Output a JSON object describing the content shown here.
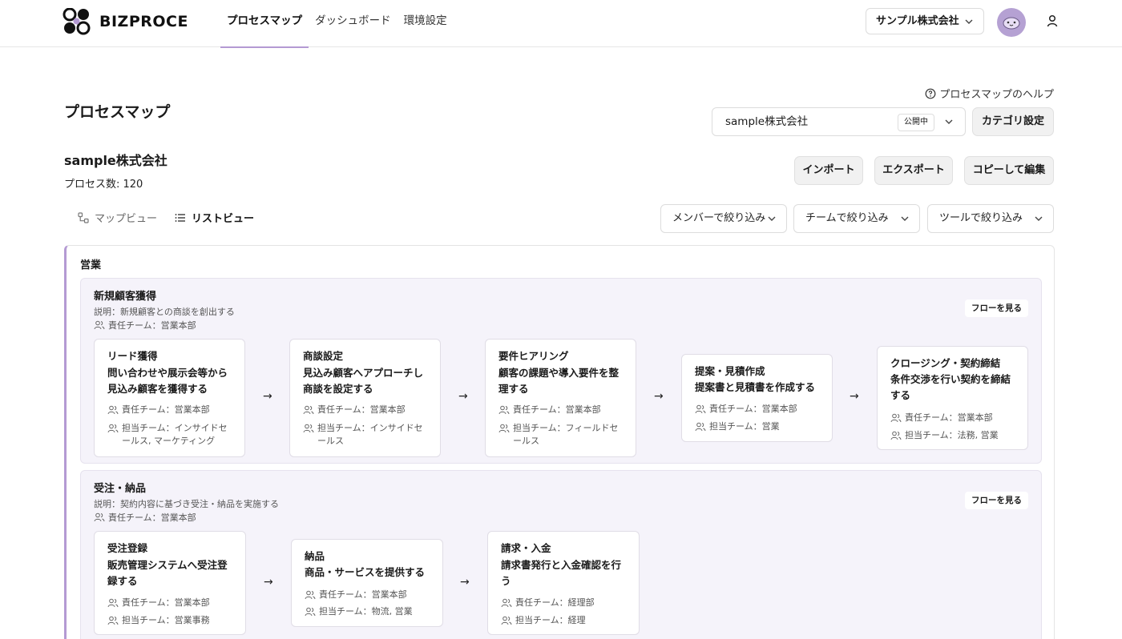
{
  "brand": {
    "name": "BIZPROCE"
  },
  "nav": {
    "items": [
      {
        "label": "プロセスマップ",
        "active": true
      },
      {
        "label": "ダッシュボード",
        "active": false
      },
      {
        "label": "環境設定",
        "active": false
      }
    ]
  },
  "header": {
    "org_select": "サンプル株式会社"
  },
  "page": {
    "title": "プロセスマップ",
    "help_link": "プロセスマップのヘルプ",
    "company_select": "sample株式会社",
    "status_badge": "公開中",
    "category_settings": "カテゴリ設定",
    "org_name": "sample株式会社",
    "process_count": "プロセス数: 120",
    "actions": {
      "import": "インポート",
      "export": "エクスポート",
      "copy_edit": "コピーして編集"
    },
    "view_tabs": {
      "map": "マップビュー",
      "list": "リストビュー"
    },
    "filters": {
      "member": "メンバーで絞り込み",
      "team": "チームで絞り込み",
      "tool": "ツールで絞り込み"
    }
  },
  "category": {
    "title": "営業",
    "groups": [
      {
        "title": "新規顧客獲得",
        "description": "説明：新規顧客との商談を創出する",
        "team": "責任チーム：営業本部",
        "flow_button": "フローを見る",
        "cards": [
          {
            "title": "リード獲得",
            "desc": "問い合わせや展示会等から見込み顧客を獲得する",
            "owner": "責任チーム：営業本部",
            "assignee": "担当チーム：インサイドセールス, マーケティング"
          },
          {
            "title": "商談設定",
            "desc": "見込み顧客へアプローチし商談を設定する",
            "owner": "責任チーム：営業本部",
            "assignee": "担当チーム：インサイドセールス"
          },
          {
            "title": "要件ヒアリング",
            "desc": "顧客の課題や導入要件を整理する",
            "owner": "責任チーム：営業本部",
            "assignee": "担当チーム：フィールドセールス"
          },
          {
            "title": "提案・見積作成",
            "desc": "提案書と見積書を作成する",
            "owner": "責任チーム：営業本部",
            "assignee": "担当チーム：営業"
          },
          {
            "title": "クロージング・契約締結",
            "desc": "条件交渉を行い契約を締結する",
            "owner": "責任チーム：営業本部",
            "assignee": "担当チーム：法務, 営業"
          }
        ]
      },
      {
        "title": "受注・納品",
        "description": "説明：契約内容に基づき受注・納品を実施する",
        "team": "責任チーム：営業本部",
        "flow_button": "フローを見る",
        "cards": [
          {
            "title": "受注登録",
            "desc": "販売管理システムへ受注登録する",
            "owner": "責任チーム：営業本部",
            "assignee": "担当チーム：営業事務"
          },
          {
            "title": "納品",
            "desc": "商品・サービスを提供する",
            "owner": "責任チーム：営業本部",
            "assignee": "担当チーム：物流, 営業"
          },
          {
            "title": "請求・入金",
            "desc": "請求書発行と入金確認を行う",
            "owner": "責任チーム：経理部",
            "assignee": "担当チーム：経理"
          }
        ]
      }
    ]
  },
  "colors": {
    "accent": "#b49ad3",
    "group_bg": "#f5f3fa",
    "button_bg": "#f1f1f1"
  },
  "icons": [
    "logo-icon",
    "chevron-down-icon",
    "avatar-icon",
    "user-icon",
    "help-icon",
    "map-view-icon",
    "list-view-icon",
    "team-icon",
    "arrow-right-icon"
  ]
}
